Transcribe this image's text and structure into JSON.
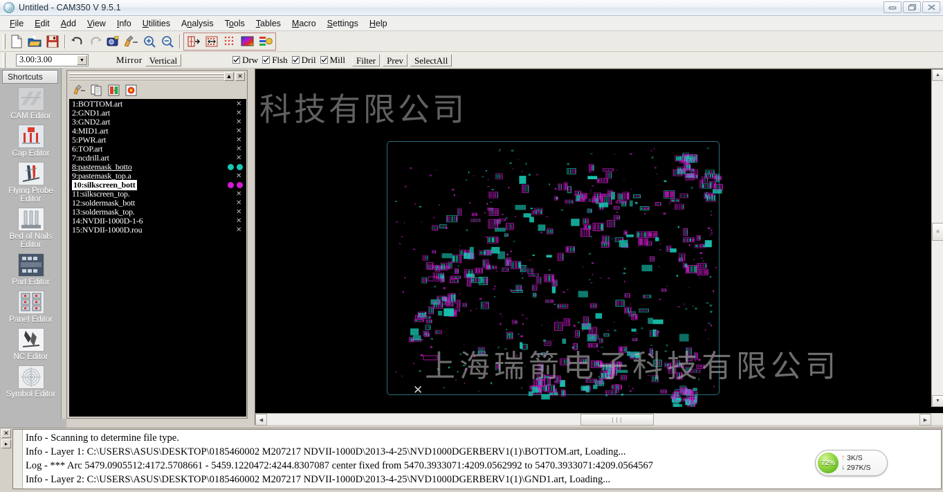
{
  "window": {
    "title": "Untitled - CAM350 V 9.5.1",
    "app_icon": "cam350-logo-icon",
    "controls": [
      {
        "name": "minimize-button",
        "glyph": "minimize-icon"
      },
      {
        "name": "restore-button",
        "glyph": "restore-icon"
      },
      {
        "name": "close-button",
        "glyph": "close-icon"
      }
    ]
  },
  "menubar": {
    "items": [
      {
        "label": "File",
        "accel": "F"
      },
      {
        "label": "Edit",
        "accel": "E"
      },
      {
        "label": "Add",
        "accel": "A"
      },
      {
        "label": "View",
        "accel": "V"
      },
      {
        "label": "Info",
        "accel": "I"
      },
      {
        "label": "Utilities",
        "accel": "U"
      },
      {
        "label": "Analysis",
        "accel": "n"
      },
      {
        "label": "Tools",
        "accel": "o"
      },
      {
        "label": "Tables",
        "accel": "T"
      },
      {
        "label": "Macro",
        "accel": "M"
      },
      {
        "label": "Settings",
        "accel": "S"
      },
      {
        "label": "Help",
        "accel": "H"
      }
    ]
  },
  "toolbar": {
    "buttons": [
      {
        "name": "new-file-button",
        "icon": "new-document-icon"
      },
      {
        "name": "open-file-button",
        "icon": "open-folder-icon"
      },
      {
        "name": "save-file-button",
        "icon": "floppy-save-icon"
      },
      {
        "name": "undo-button",
        "icon": "undo-arrow-icon"
      },
      {
        "name": "redo-button",
        "icon": "redo-arrow-icon"
      },
      {
        "name": "query-button",
        "icon": "camera-query-icon"
      },
      {
        "name": "paint-button",
        "icon": "paint-brush-icon"
      },
      {
        "name": "zoom-in-button",
        "icon": "magnifier-plus-icon"
      },
      {
        "name": "zoom-out-button",
        "icon": "magnifier-minus-icon"
      },
      {
        "name": "align-layer-button",
        "icon": "align-layers-icon"
      },
      {
        "name": "nc-tool-button",
        "icon": "drill-grid-icon"
      },
      {
        "name": "drill-pattern-button",
        "icon": "red-dot-grid-icon"
      },
      {
        "name": "color-palette-button",
        "icon": "color-spectrum-icon"
      },
      {
        "name": "layer-color-button",
        "icon": "layer-color-icon"
      }
    ]
  },
  "toolbar2": {
    "aperture_value": "3.00:3.00",
    "mirror_label": "Mirror",
    "mirror_value": "Vertical",
    "checkboxes": [
      {
        "label": "Drw",
        "checked": true
      },
      {
        "label": "Flsh",
        "checked": true
      },
      {
        "label": "Dril",
        "checked": true
      },
      {
        "label": "Mill",
        "checked": true
      }
    ],
    "buttons": [
      {
        "label": "Filter"
      },
      {
        "label": "Prev"
      },
      {
        "label": "SelectAll"
      }
    ]
  },
  "sidebar": {
    "header": "Shortcuts",
    "items": [
      {
        "label": "CAM Editor",
        "icon": "cam-editor-icon"
      },
      {
        "label": "Cap Editor",
        "icon": "cap-editor-icon"
      },
      {
        "label": "Flying Probe\nEditor",
        "icon": "flying-probe-editor-icon"
      },
      {
        "label": "Bed of Nails\nEditor",
        "icon": "bed-of-nails-editor-icon"
      },
      {
        "label": "Part Editor",
        "icon": "part-editor-icon"
      },
      {
        "label": "Panel Editor",
        "icon": "panel-editor-icon"
      },
      {
        "label": "NC Editor",
        "icon": "nc-editor-icon"
      },
      {
        "label": "Symbol Editor",
        "icon": "symbol-editor-icon"
      }
    ]
  },
  "layer_panel": {
    "title_controls": [
      {
        "name": "restore-button",
        "glyph": "▲"
      },
      {
        "name": "close-button",
        "glyph": "✕"
      }
    ],
    "tools": [
      {
        "name": "layer-paint-button",
        "icon": "paint-brush-icon"
      },
      {
        "name": "layer-copy-button",
        "icon": "copy-pages-icon"
      },
      {
        "name": "layer-merge-button",
        "icon": "merge-layers-icon"
      },
      {
        "name": "layer-delete-button",
        "icon": "delete-layer-icon"
      }
    ],
    "layers": [
      {
        "num": "1",
        "name": "BOTTOM.art",
        "visible": false,
        "selected": false,
        "underline": false,
        "swatch_a": null,
        "swatch_b": null
      },
      {
        "num": "2",
        "name": "GND1.art",
        "visible": false,
        "selected": false,
        "underline": false,
        "swatch_a": null,
        "swatch_b": null
      },
      {
        "num": "3",
        "name": "GND2.art",
        "visible": false,
        "selected": false,
        "underline": false,
        "swatch_a": null,
        "swatch_b": null
      },
      {
        "num": "4",
        "name": "MID1.art",
        "visible": false,
        "selected": false,
        "underline": false,
        "swatch_a": null,
        "swatch_b": null
      },
      {
        "num": "5",
        "name": "PWR.art",
        "visible": false,
        "selected": false,
        "underline": false,
        "swatch_a": null,
        "swatch_b": null
      },
      {
        "num": "6",
        "name": "TOP.art",
        "visible": false,
        "selected": false,
        "underline": false,
        "swatch_a": null,
        "swatch_b": null
      },
      {
        "num": "7",
        "name": "ncdrill.art",
        "visible": false,
        "selected": false,
        "underline": false,
        "swatch_a": null,
        "swatch_b": null
      },
      {
        "num": "8",
        "name": "pastemask_botto",
        "visible": true,
        "selected": false,
        "underline": true,
        "swatch_a": "#18c8b4",
        "swatch_b": "#18c8b4"
      },
      {
        "num": "9",
        "name": "pastemask_top.a",
        "visible": false,
        "selected": false,
        "underline": false,
        "swatch_a": null,
        "swatch_b": null
      },
      {
        "num": "10",
        "name": "silkscreen_bott",
        "visible": true,
        "selected": true,
        "underline": false,
        "swatch_a": "#d41ad4",
        "swatch_b": "#d41ad4"
      },
      {
        "num": "11",
        "name": "silkscreen_top.",
        "visible": false,
        "selected": false,
        "underline": false,
        "swatch_a": null,
        "swatch_b": null
      },
      {
        "num": "12",
        "name": "soldermask_bott",
        "visible": false,
        "selected": false,
        "underline": false,
        "swatch_a": null,
        "swatch_b": null
      },
      {
        "num": "13",
        "name": "soldermask_top.",
        "visible": false,
        "selected": false,
        "underline": false,
        "swatch_a": null,
        "swatch_b": null
      },
      {
        "num": "14",
        "name": "NVDII-1000D-1-6",
        "visible": false,
        "selected": false,
        "underline": false,
        "swatch_a": null,
        "swatch_b": null
      },
      {
        "num": "15",
        "name": "NVDII-1000D.rou",
        "visible": false,
        "selected": false,
        "underline": false,
        "swatch_a": null,
        "swatch_b": null
      }
    ]
  },
  "canvas": {
    "watermark_top": "上海瑞箭电子科技有限公司",
    "watermark_center": "上海瑞箭电子科技有限公司",
    "origin_marker": "✕",
    "board_outline_color": "#2d6f7a",
    "silkscreen_color": "#d41ad4",
    "pastemask_color": "#18c8b4"
  },
  "log_panel": {
    "close_glyph": "✕",
    "scroll_glyph": "▸",
    "lines": [
      "Info - Scanning to determine file type.",
      "Info - Layer 1: C:\\USERS\\ASUS\\DESKTOP\\0185460002 M207217 NDVII-1000D\\2013-4-25\\NVD1000DGERBERV1(1)\\BOTTOM.art, Loading...",
      "Log - *** Arc 5479.0905512:4172.5708661 - 5459.1220472:4244.8307087 center fixed from 5470.3933071:4209.0562992 to 5470.3933071:4209.0564567",
      "Info - Layer 2: C:\\USERS\\ASUS\\DESKTOP\\0185460002 M207217 NDVII-1000D\\2013-4-25\\NVD1000DGERBERV1(1)\\GND1.art, Loading..."
    ]
  },
  "net_widget": {
    "percent": "72%",
    "upload": "3K/S",
    "download": "297K/S",
    "up_arrow": "↑",
    "down_arrow": "↓"
  }
}
